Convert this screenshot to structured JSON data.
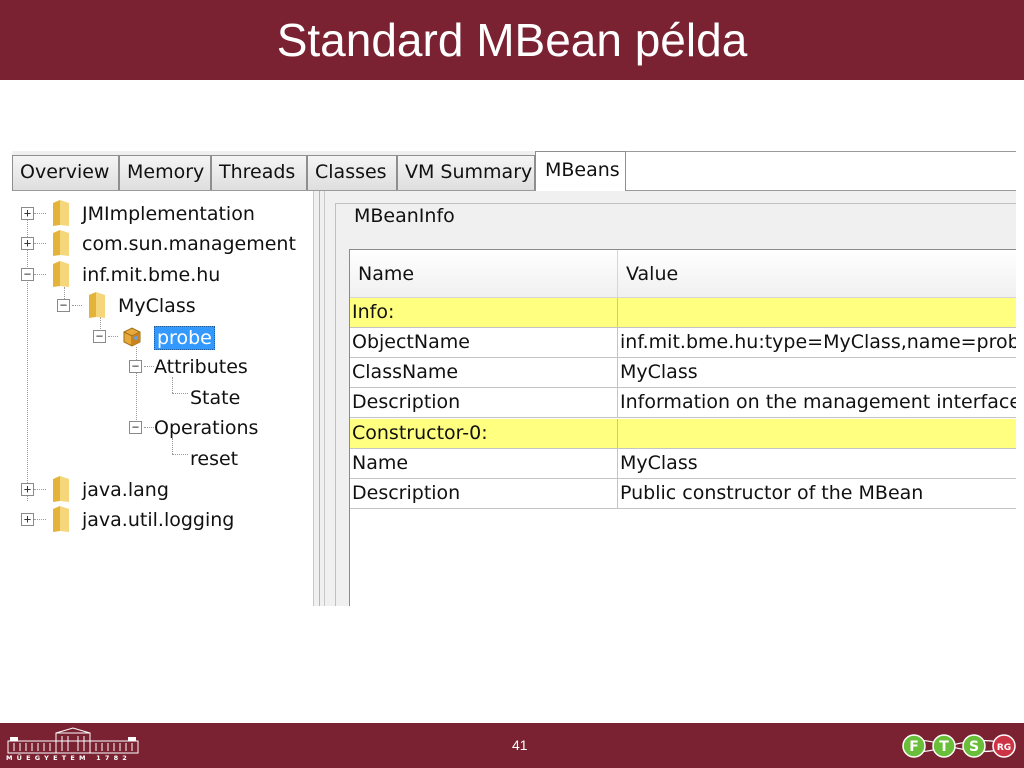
{
  "slide": {
    "title": "Standard MBean példa",
    "page_number": "41",
    "bme_logo_text": "MŰEGYETEM 1782",
    "ftsrg_logo_letters": [
      "F",
      "T",
      "S",
      "RG"
    ],
    "colors": {
      "band": "#7a2232",
      "section_highlight": "#ffff80",
      "selection": "#3399ff"
    }
  },
  "tabs": [
    "Overview",
    "Memory",
    "Threads",
    "Classes",
    "VM Summary",
    "MBeans"
  ],
  "active_tab": "MBeans",
  "tree": {
    "nodes": [
      {
        "label": "JMImplementation",
        "expander": "+",
        "icon": "folder-icon"
      },
      {
        "label": "com.sun.management",
        "expander": "+",
        "icon": "folder-icon"
      },
      {
        "label": "inf.mit.bme.hu",
        "expander": "−",
        "icon": "folder-icon"
      },
      {
        "label": "MyClass",
        "expander": "−",
        "icon": "folder-icon"
      },
      {
        "label": "probe",
        "expander": "−",
        "icon": "mbean-icon",
        "selected": true
      },
      {
        "label": "Attributes",
        "expander": "−"
      },
      {
        "label": "State"
      },
      {
        "label": "Operations",
        "expander": "−"
      },
      {
        "label": "reset"
      },
      {
        "label": "java.lang",
        "expander": "+",
        "icon": "folder-icon"
      },
      {
        "label": "java.util.logging",
        "expander": "+",
        "icon": "folder-icon"
      }
    ]
  },
  "mbean_info": {
    "group_title": "MBeanInfo",
    "columns": [
      "Name",
      "Value"
    ],
    "rows": [
      {
        "name": "Info:",
        "value": "",
        "section": true
      },
      {
        "name": "ObjectName",
        "value": "inf.mit.bme.hu:type=MyClass,name=probe"
      },
      {
        "name": "ClassName",
        "value": "MyClass"
      },
      {
        "name": "Description",
        "value": "Information on the management interface of"
      },
      {
        "name": "Constructor-0:",
        "value": "",
        "section": true
      },
      {
        "name": "Name",
        "value": "MyClass"
      },
      {
        "name": "Description",
        "value": "Public constructor of the MBean"
      }
    ]
  }
}
